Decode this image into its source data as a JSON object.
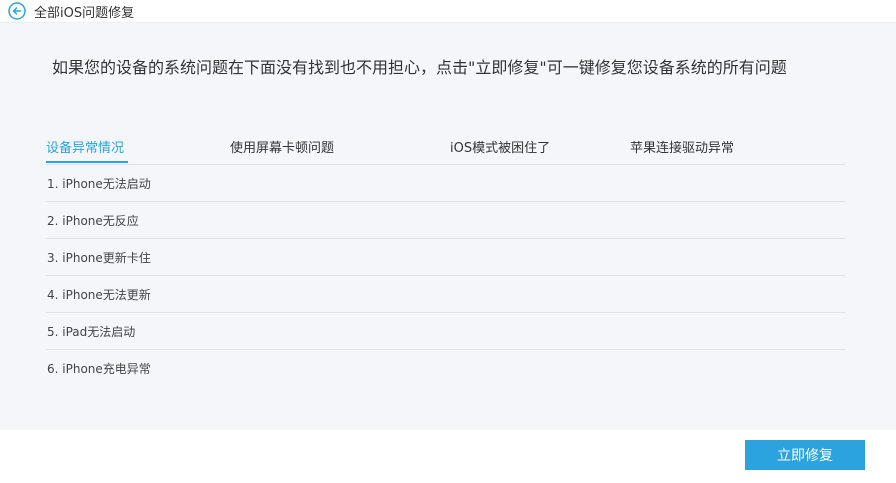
{
  "header": {
    "title": "全部iOS问题修复",
    "back_icon": "arrow-left-circle-icon"
  },
  "intro": {
    "text": "如果您的设备的系统问题在下面没有找到也不用担心，点击\"立即修复\"可一键修复您设备系统的所有问题"
  },
  "tabs": [
    {
      "label": "设备异常情况",
      "active": true
    },
    {
      "label": "使用屏幕卡顿问题",
      "active": false
    },
    {
      "label": "iOS模式被困住了",
      "active": false
    },
    {
      "label": "苹果连接驱动异常",
      "active": false
    }
  ],
  "issues": [
    {
      "label": "1. iPhone无法启动"
    },
    {
      "label": "2. iPhone无反应"
    },
    {
      "label": "3. iPhone更新卡住"
    },
    {
      "label": "4. iPhone无法更新"
    },
    {
      "label": "5. iPad无法启动"
    },
    {
      "label": "6. iPhone充电异常"
    }
  ],
  "footer": {
    "repair_button_label": "立即修复"
  },
  "colors": {
    "accent": "#2ba3df",
    "background": "#f5f6fa"
  }
}
